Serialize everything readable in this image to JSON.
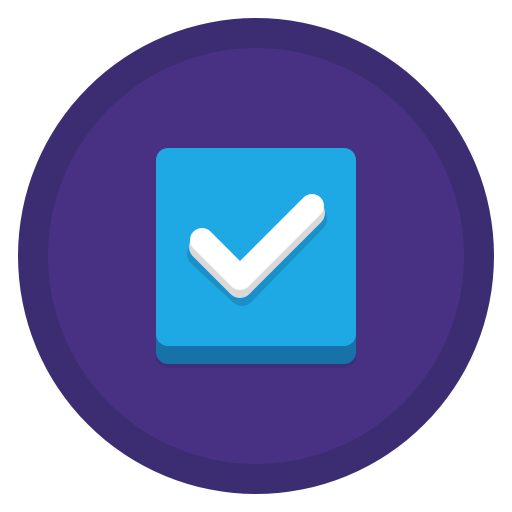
{
  "icon": {
    "name": "checkbox-checked-icon",
    "checked": true,
    "colors": {
      "outer_ring": "#3c2d73",
      "inner_disc": "#483183",
      "box_face": "#1ea9e5",
      "box_base": "#1672a8",
      "box_shadow": "#3d2c70",
      "check_mark": "#ffffff",
      "check_mark_edge": "#d9d9d9",
      "check_shadow": "#1a8fc8"
    }
  }
}
